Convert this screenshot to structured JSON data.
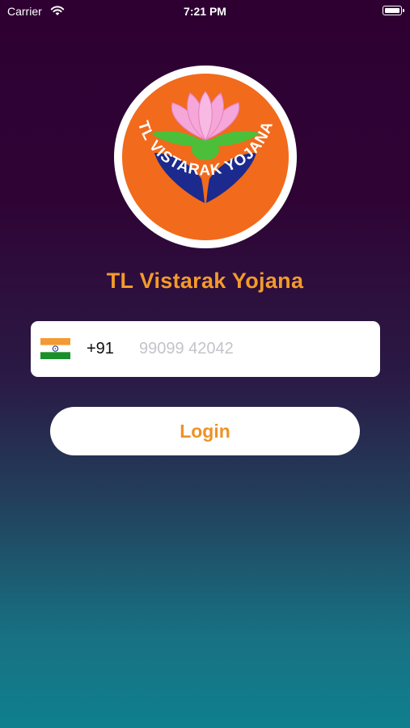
{
  "status_bar": {
    "carrier": "Carrier",
    "time": "7:21 PM"
  },
  "logo": {
    "text": "TL VISTARAK YOJANA",
    "icon": "lotus-hands-logo",
    "colors": {
      "ring": "#ffffff",
      "background": "#f26a1b",
      "petals": "#f4a7d8",
      "leaves": "#4bbf3a",
      "hands": "#1b2a8c"
    }
  },
  "app_title": "TL Vistarak Yojana",
  "phone": {
    "country_flag": "india-flag-icon",
    "dial_code": "+91",
    "placeholder": "99099 42042",
    "value": ""
  },
  "login_label": "Login",
  "colors": {
    "accent": "#f39a2a",
    "gradient_top": "#2e0032",
    "gradient_bottom": "#0f7f8e"
  }
}
